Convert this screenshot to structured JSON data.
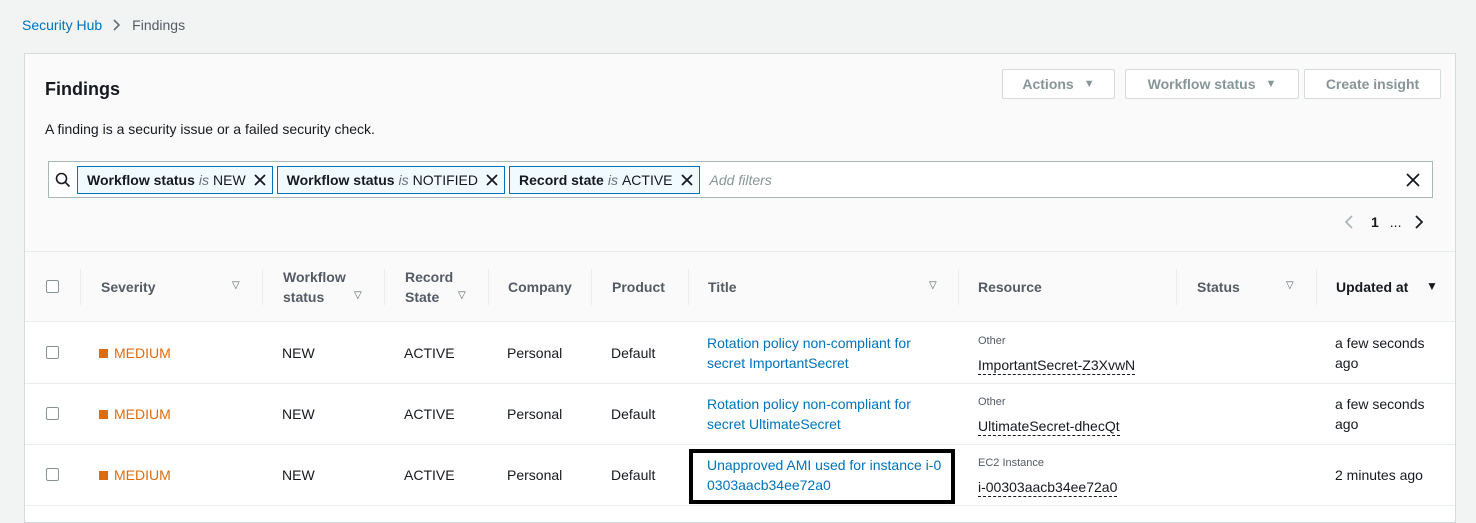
{
  "breadcrumb": {
    "root": "Security Hub",
    "current": "Findings"
  },
  "panel": {
    "title": "Findings",
    "description": "A finding is a security issue or a failed security check."
  },
  "buttons": {
    "actions": "Actions",
    "workflow_status": "Workflow status",
    "create_insight": "Create insight"
  },
  "filters": {
    "tokens": [
      {
        "key": "Workflow status",
        "op": "is",
        "value": "NEW"
      },
      {
        "key": "Workflow status",
        "op": "is",
        "value": "NOTIFIED"
      },
      {
        "key": "Record state",
        "op": "is",
        "value": "ACTIVE"
      }
    ],
    "placeholder": "Add filters"
  },
  "pagination": {
    "page": "1",
    "ellipsis": "..."
  },
  "columns": {
    "severity": "Severity",
    "workflow_status_l1": "Workflow",
    "workflow_status_l2": "status",
    "record_state_l1": "Record",
    "record_state_l2": "State",
    "company": "Company",
    "product": "Product",
    "title": "Title",
    "resource": "Resource",
    "status": "Status",
    "updated_at": "Updated at"
  },
  "rows": [
    {
      "severity": "MEDIUM",
      "workflow": "NEW",
      "record_state": "ACTIVE",
      "company": "Personal",
      "product": "Default",
      "title": "Rotation policy non-compliant for secret ImportantSecret",
      "resource_type": "Other",
      "resource_id": "ImportantSecret-Z3XvwN",
      "status": "",
      "updated": "a few seconds ago"
    },
    {
      "severity": "MEDIUM",
      "workflow": "NEW",
      "record_state": "ACTIVE",
      "company": "Personal",
      "product": "Default",
      "title": "Rotation policy non-compliant for secret UltimateSecret",
      "resource_type": "Other",
      "resource_id": "UltimateSecret-dhecQt",
      "status": "",
      "updated": "a few seconds ago"
    },
    {
      "severity": "MEDIUM",
      "workflow": "NEW",
      "record_state": "ACTIVE",
      "company": "Personal",
      "product": "Default",
      "title": "Unapproved AMI used for instance i-00303aacb34ee72a0",
      "resource_type": "EC2 Instance",
      "resource_id": "i-00303aacb34ee72a0",
      "status": "",
      "updated": "2 minutes ago"
    }
  ],
  "colors": {
    "accent": "#0073bb",
    "severity_medium": "#dd6b10",
    "highlight_box": "#000000"
  },
  "icons": [
    "search-icon",
    "close-icon",
    "caret-down-icon",
    "chevron-left-icon",
    "chevron-right-icon",
    "sort-icon",
    "checkbox"
  ]
}
